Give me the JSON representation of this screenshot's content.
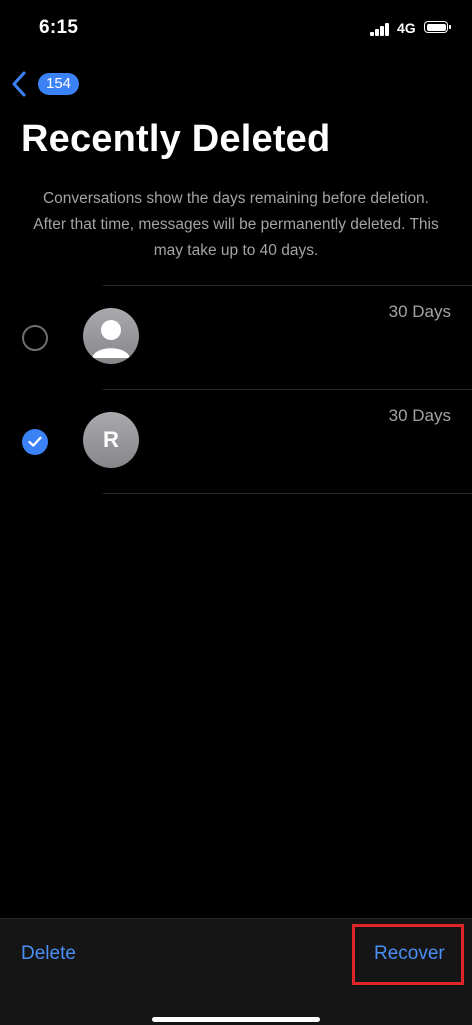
{
  "status_bar": {
    "time": "6:15",
    "network": "4G"
  },
  "nav": {
    "back_count": "154"
  },
  "page": {
    "title": "Recently Deleted",
    "description": "Conversations show the days remaining before deletion. After that time, messages will be permanently deleted. This may take up to 40 days."
  },
  "conversations": [
    {
      "selected": false,
      "avatar": "person-silhouette-icon",
      "days": "30 Days"
    },
    {
      "selected": true,
      "avatar_initial": "R",
      "days": "30 Days"
    }
  ],
  "toolbar": {
    "delete_label": "Delete",
    "recover_label": "Recover"
  },
  "colors": {
    "accent": "#4a8ff5",
    "highlight": "#e0262a",
    "background": "#000000"
  }
}
